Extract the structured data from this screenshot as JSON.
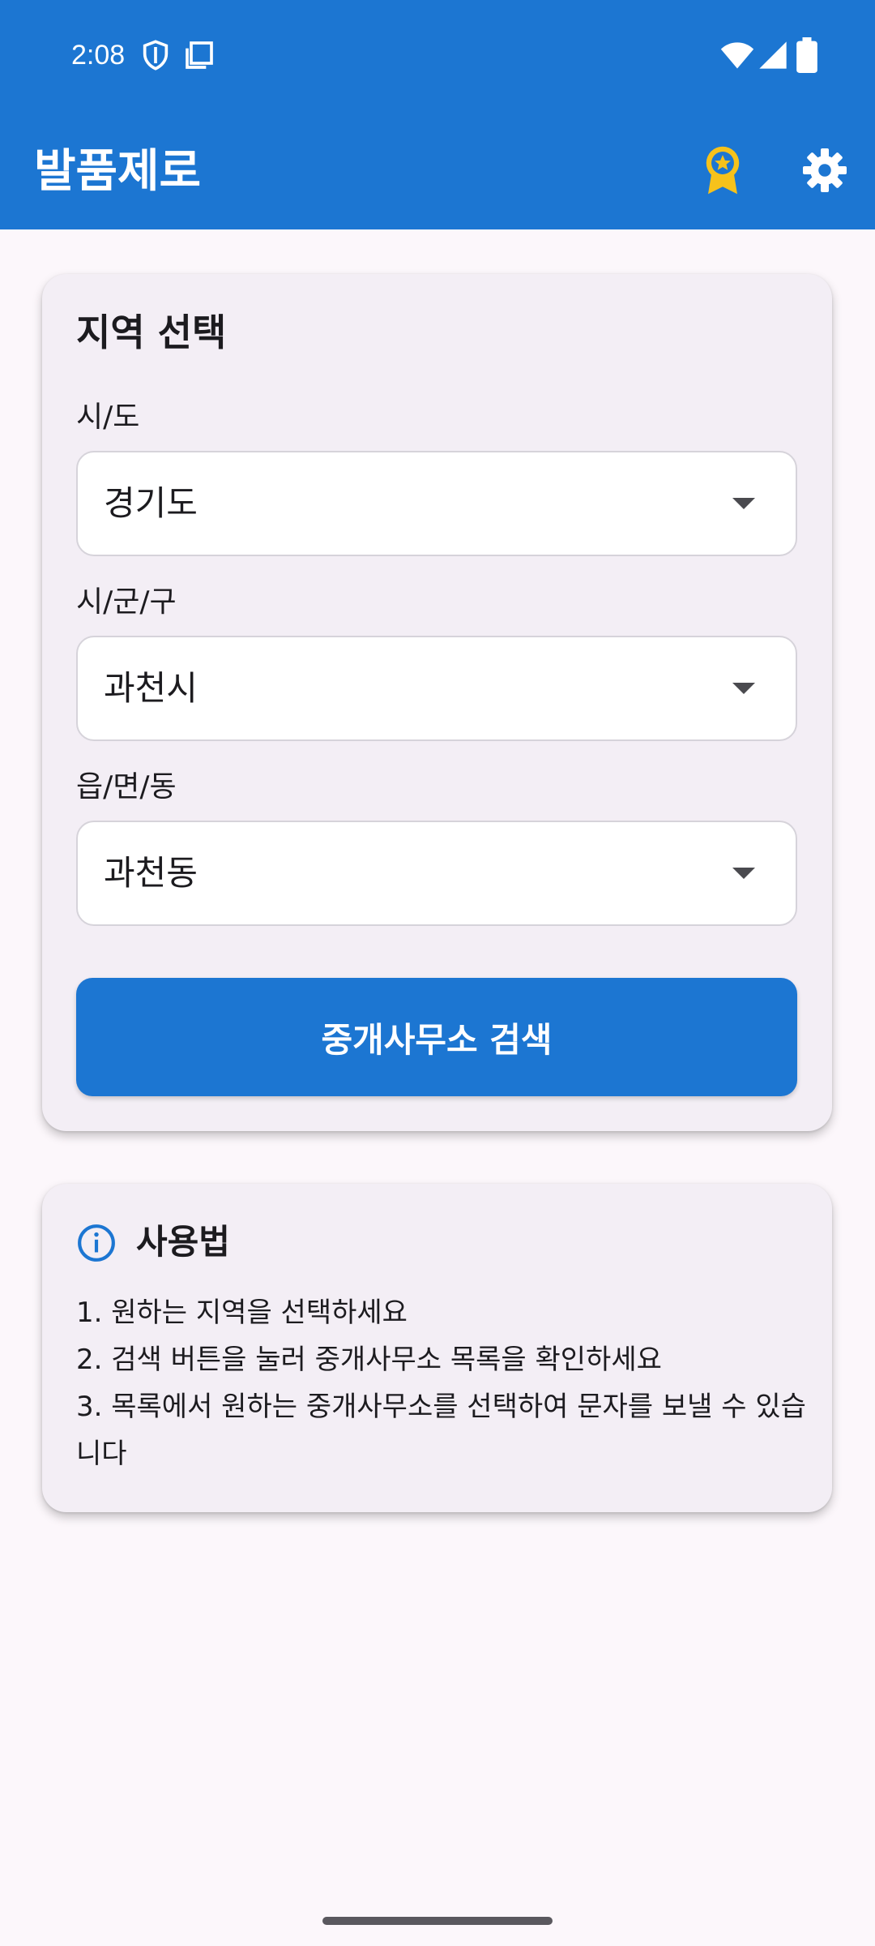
{
  "status_bar": {
    "time": "2:08",
    "icons": [
      "shield-icon",
      "screenshot-icon",
      "wifi-icon",
      "signal-icon",
      "battery-icon"
    ]
  },
  "app_bar": {
    "title": "발품제로",
    "actions": [
      "award-icon",
      "settings-icon"
    ],
    "award_color": "#f6c21b"
  },
  "region_card": {
    "title": "지역 선택",
    "province": {
      "label": "시/도",
      "value": "경기도"
    },
    "city": {
      "label": "시/군/구",
      "value": "과천시"
    },
    "district": {
      "label": "읍/면/동",
      "value": "과천동"
    },
    "search_button": "중개사무소 검색"
  },
  "help_card": {
    "title": "사용법",
    "steps": [
      "1. 원하는 지역을 선택하세요",
      "2. 검색 버튼을 눌러 중개사무소 목록을 확인하세요",
      "3. 목록에서 원하는 중개사무소를 선택하여 문자를 보낼 수 있습니다"
    ]
  },
  "colors": {
    "primary": "#1c76d2",
    "background": "#fcf7fb",
    "card": "#f3eef5"
  }
}
